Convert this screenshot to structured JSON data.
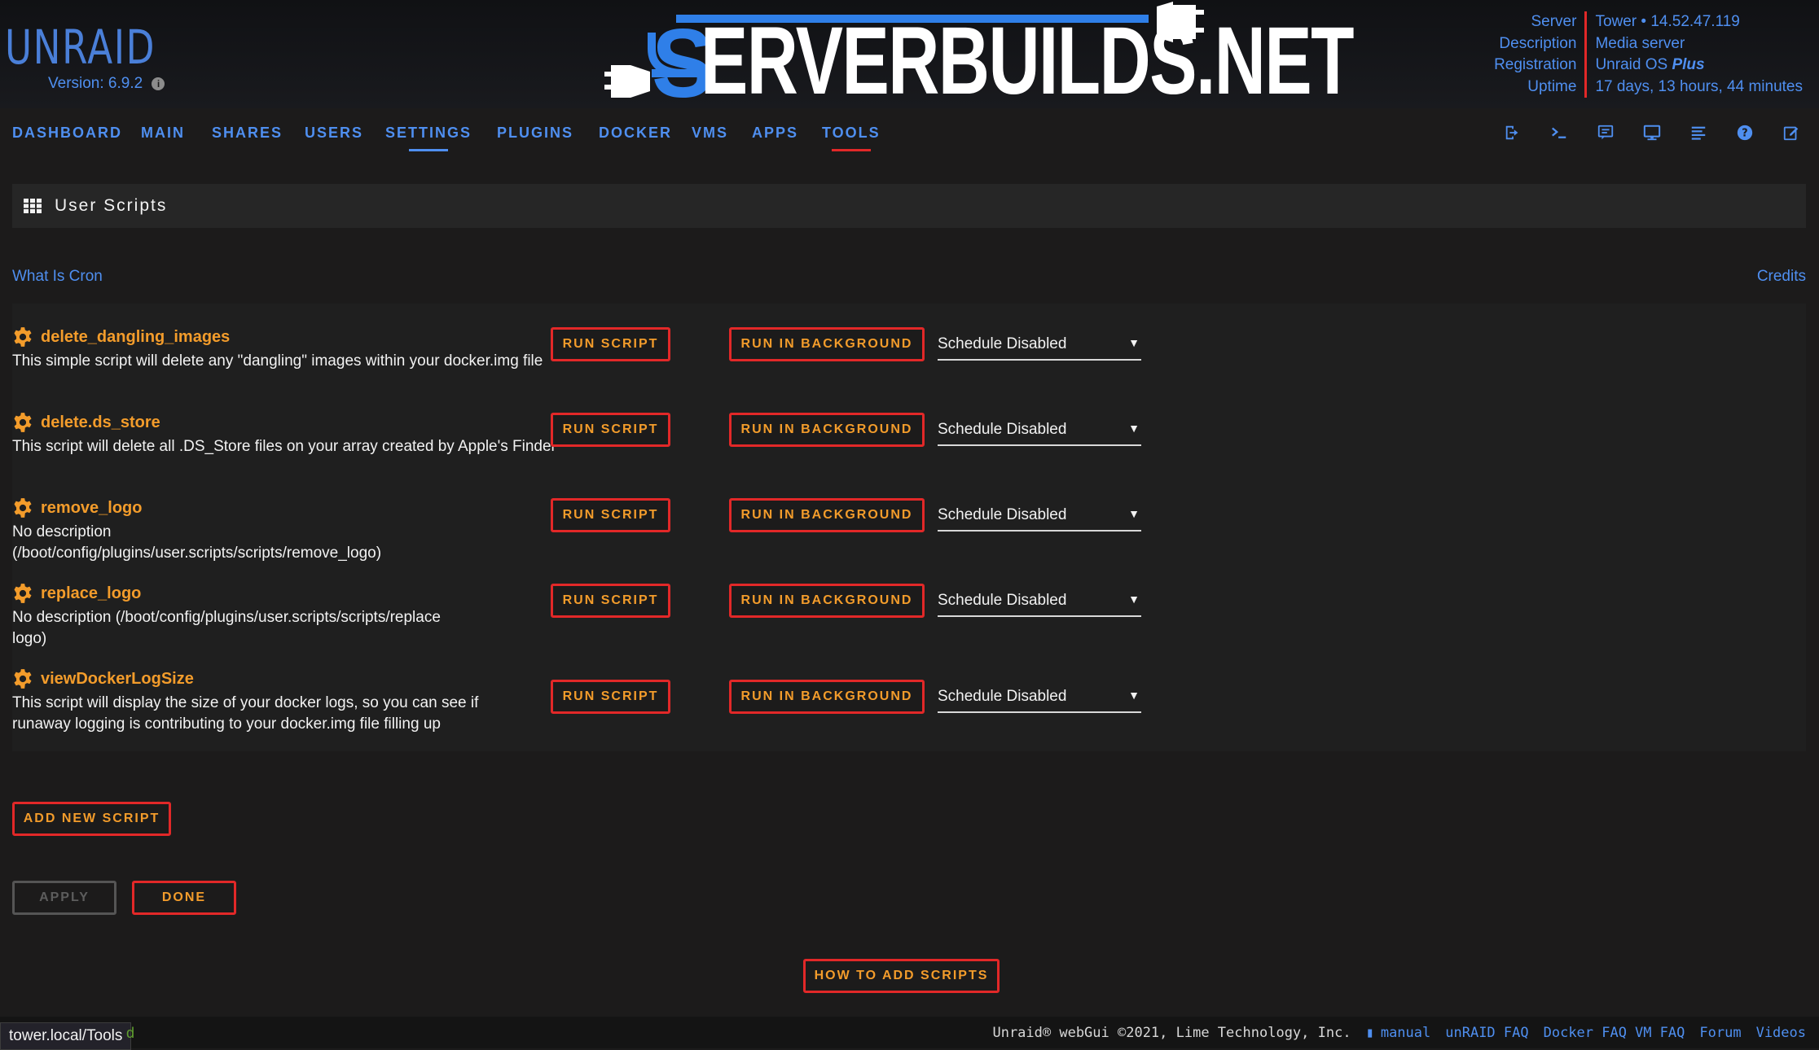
{
  "header": {
    "logo_text": "UNRAID",
    "version_label": "Version: 6.9.2",
    "banner_first": "S",
    "banner_rest": "ERVERBUILDS.NET",
    "server_labels": [
      "Server",
      "Description",
      "Registration",
      "Uptime"
    ],
    "server_name": "Tower • 14.52.47.119",
    "description": "Media server",
    "registration_prefix": "Unraid OS ",
    "registration_plan": "Plus",
    "uptime": "17 days, 13 hours, 44 minutes"
  },
  "nav": {
    "items": [
      "DASHBOARD",
      "MAIN",
      "SHARES",
      "USERS",
      "SETTINGS",
      "PLUGINS",
      "DOCKER",
      "VMS",
      "APPS",
      "TOOLS"
    ],
    "icons": [
      "logout-icon",
      "terminal-icon",
      "feedback-icon",
      "monitor-icon",
      "log-icon",
      "help-icon",
      "notes-icon"
    ]
  },
  "page": {
    "title": "User Scripts",
    "link_left": "What Is Cron",
    "link_right": "Credits"
  },
  "scripts": [
    {
      "name": "delete_dangling_images",
      "description": "This simple script will delete any \"dangling\" images within your docker.img file",
      "run_label": "RUN SCRIPT",
      "bg_label": "RUN IN BACKGROUND",
      "schedule": "Schedule Disabled"
    },
    {
      "name": "delete.ds_store",
      "description": "This script will delete all .DS_Store files on your array created by Apple's Finder",
      "run_label": "RUN SCRIPT",
      "bg_label": "RUN IN BACKGROUND",
      "schedule": "Schedule Disabled"
    },
    {
      "name": "remove_logo",
      "description": "No description (/boot/config/plugins/user.scripts/scripts/remove_logo)",
      "run_label": "RUN SCRIPT",
      "bg_label": "RUN IN BACKGROUND",
      "schedule": "Schedule Disabled"
    },
    {
      "name": "replace_logo",
      "description": "No description (/boot/config/plugins/user.scripts/scripts/replace logo)",
      "run_label": "RUN SCRIPT",
      "bg_label": "RUN IN BACKGROUND",
      "schedule": "Schedule Disabled"
    },
    {
      "name": "viewDockerLogSize",
      "description": "This script will display the size of your docker logs, so you can see if runaway logging is contributing to your docker.img file filling up",
      "run_label": "RUN SCRIPT",
      "bg_label": "RUN IN BACKGROUND",
      "schedule": "Schedule Disabled"
    }
  ],
  "actions": {
    "add_new_script": "ADD NEW SCRIPT",
    "apply": "APPLY",
    "done": "DONE",
    "how_to_add": "HOW TO ADD SCRIPTS"
  },
  "footer": {
    "status_url": "tower.local/Tools",
    "status_suffix": "d",
    "copyright": "Unraid® webGui ©2021, Lime Technology, Inc.",
    "links": [
      "manual",
      "unRAID FAQ",
      "Docker FAQ",
      "VM FAQ",
      "Forum",
      "Videos"
    ]
  },
  "colors": {
    "accent_blue": "#4f8ff0",
    "accent_orange": "#f39c2b",
    "accent_red": "#e22828",
    "background": "#1c1b1b"
  }
}
